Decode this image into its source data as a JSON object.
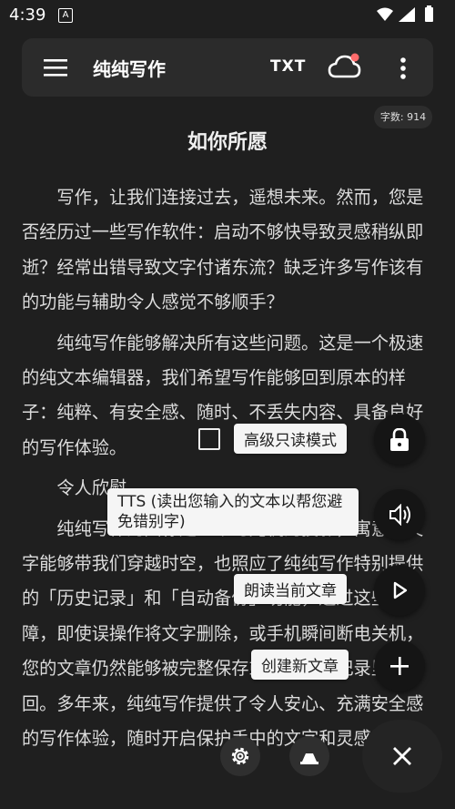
{
  "status_bar": {
    "time": "4:39",
    "notification_letter": "A"
  },
  "app_bar": {
    "title": "纯纯写作",
    "txt_label": "TXT"
  },
  "word_count": "字数: 914",
  "document": {
    "title": "如你所愿",
    "paragraphs": [
      "写作，让我们连接过去，遥想未来。然而，您是否经历过一些写作软件：启动不够快导致灵感稍纵即逝？经常出错导致文字付诸东流？缺乏许多写作该有的功能与辅助令人感觉不够顺手？",
      "纯纯写作能够解决所有这些问题。这是一个极速的纯文本编辑器，我们希望写作能够回到原本的样子：纯粹、有安全感、随时、不丢失内容、具备良好的写作体验。",
      "令人欣慰",
      "纯纯写作的图标是一个时光机的投影，寓意着文字能够带我们穿越时空，也照应了纯纯写作特别提供的「历史记录」和「自动备份」功能，通过这些保障，即使误操作将文字删除，或手机瞬间断电关机，您的文章仍然能够被完整保存或者在历史记录里找回。多年来，纯纯写作提供了令人安心、充满安全感的写作体验，随时开启保护手中的文字和灵感。"
    ]
  },
  "fab_menu": {
    "read_only_label": "高级只读模式",
    "tts_label": "TTS (读出您输入的文本以帮您避免错别字)",
    "read_aloud_label": "朗读当前文章",
    "new_article_label": "创建新文章"
  },
  "colors": {
    "background": "#1f1f1f",
    "chip": "#f5f5f5",
    "fab": "#151515",
    "sync_dot": "#ff6b6b"
  }
}
